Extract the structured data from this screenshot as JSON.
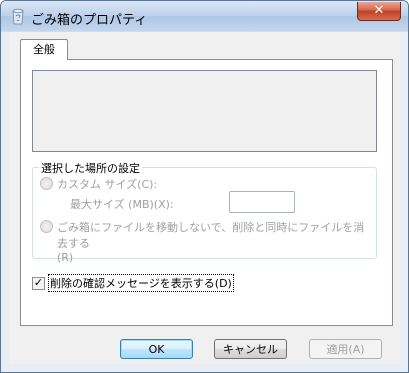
{
  "window": {
    "title": "ごみ箱のプロパティ",
    "close_label": "✕"
  },
  "tabs": [
    {
      "label": "全般"
    }
  ],
  "group": {
    "legend": "選択した場所の設定",
    "custom_size_label": "カスタム サイズ(C):",
    "max_size_label": "最大サイズ (MB)(X):",
    "max_size_value": "",
    "no_recycle_label_line1": "ごみ箱にファイルを移動しないで、削除と同時にファイルを消去する",
    "no_recycle_label_line2": "(R)"
  },
  "confirm": {
    "label": "削除の確認メッセージを表示する(D)",
    "checked": true
  },
  "buttons": {
    "ok": "OK",
    "cancel": "キャンセル",
    "apply": "適用(A)"
  }
}
